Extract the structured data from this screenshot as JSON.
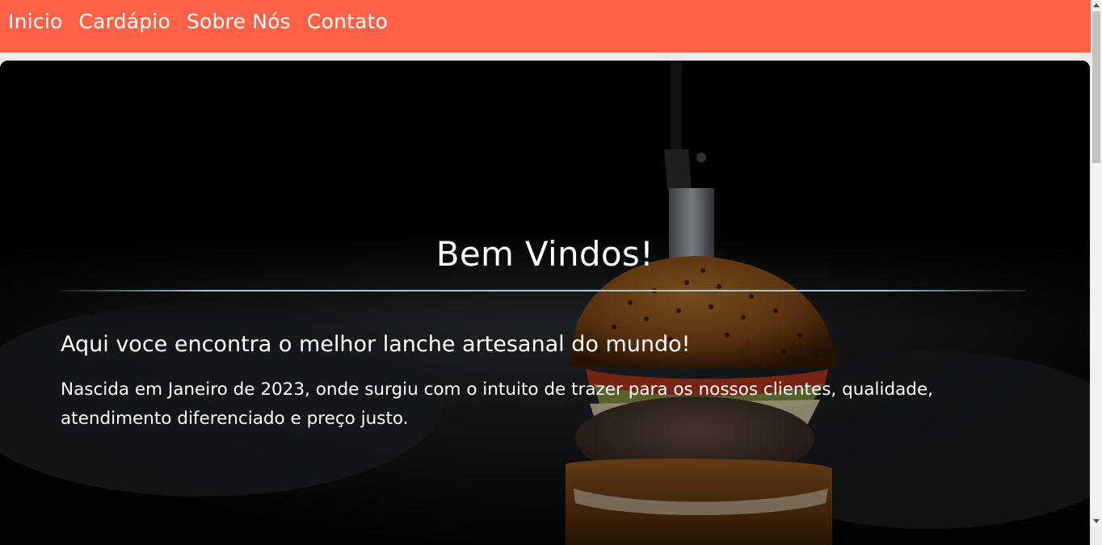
{
  "nav": {
    "items": [
      {
        "label": "Inicio"
      },
      {
        "label": "Cardápio"
      },
      {
        "label": "Sobre Nós"
      },
      {
        "label": "Contato"
      }
    ]
  },
  "hero": {
    "title": "Bem Vindos!",
    "subtitle": "Aqui voce encontra o melhor lanche artesanal do mundo!",
    "text": "Nascida em Janeiro de 2023, onde surgiu com o intuito de trazer para os nossos clientes, qualidade, atendimento diferenciado e preço justo."
  },
  "colors": {
    "nav_background": "#ff6347",
    "page_background": "#ebebeb",
    "text": "#ffffff",
    "divider": "#a6c8cb"
  }
}
